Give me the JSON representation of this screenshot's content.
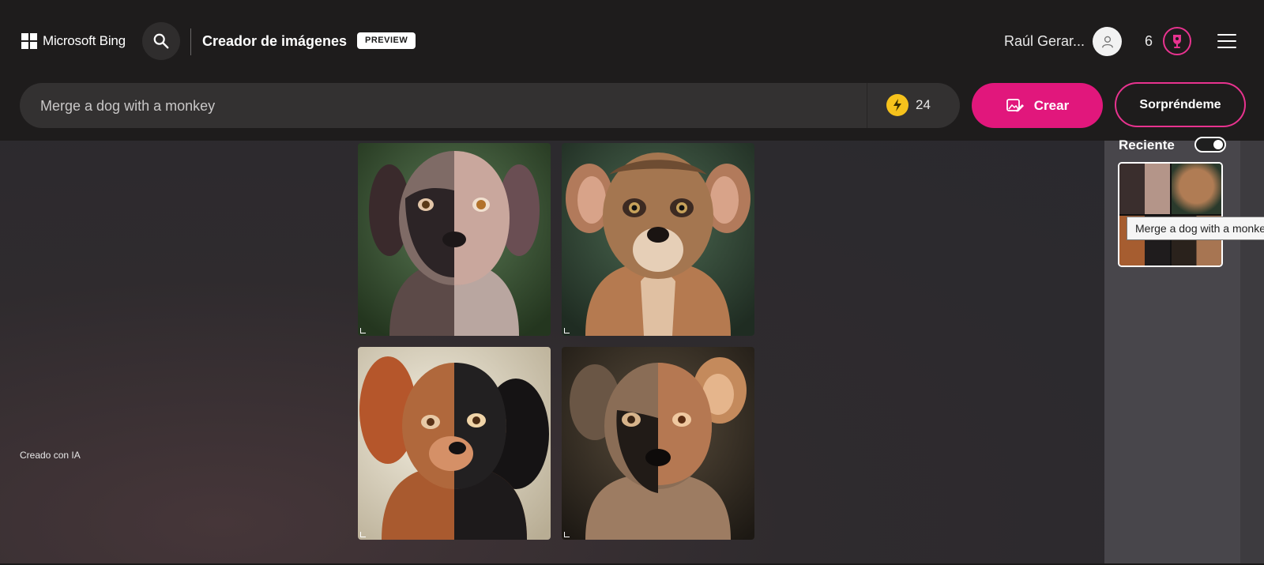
{
  "header": {
    "brand": "Microsoft Bing",
    "title": "Creador de imágenes",
    "badge": "PREVIEW",
    "user_name": "Raúl Gerar...",
    "rewards_count": "6"
  },
  "prompt": {
    "value": "Merge a dog with a monkey",
    "boosts": "24",
    "create_label": "Crear",
    "surprise_label": "Sorpréndeme"
  },
  "main": {
    "created_label": "Creado con IA",
    "images": [
      {
        "alt": "dog-monkey image 1"
      },
      {
        "alt": "dog-monkey image 2"
      },
      {
        "alt": "dog-monkey image 3"
      },
      {
        "alt": "dog-monkey image 4"
      }
    ]
  },
  "sidebar": {
    "recent_label": "Reciente",
    "tooltip": "Merge a dog with a monke"
  },
  "colors": {
    "accent": "#e1177c",
    "header_bg": "#1e1c1c",
    "sidebar_bg": "#48464b"
  }
}
